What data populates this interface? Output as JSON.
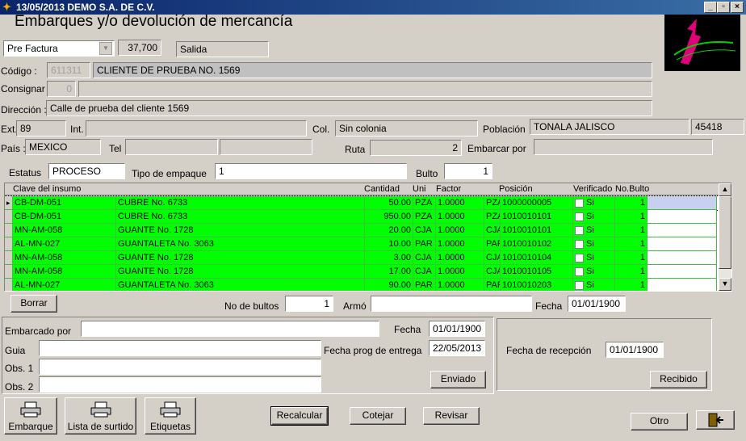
{
  "window": {
    "title": "13/05/2013  DEMO  S.A. DE C.V.",
    "heading": "Embarques y/o devolución de mercancía"
  },
  "header": {
    "doc_type": "Pre Factura",
    "number": "37,700",
    "movement": "Salida"
  },
  "customer": {
    "codigo_label": "Código :",
    "codigo": "611311",
    "nombre": "CLIENTE DE PRUEBA NO. 1569",
    "consignar_label": "Consignar",
    "consignar": "0",
    "direccion_label": "Dirección :",
    "direccion": "Calle de prueba del cliente 1569",
    "ext_label": "Ext.",
    "ext": "89",
    "int_label": "Int.",
    "int": "",
    "col_label": "Col.",
    "colonia": "Sin colonia",
    "poblacion_label": "Población",
    "poblacion": "TONALA  JALISCO",
    "cp": "45418",
    "pais_label": "País :",
    "pais": "MEXICO",
    "tel_label": "Tel",
    "ruta_label": "Ruta",
    "ruta": "2",
    "embarcar_label": "Embarcar por",
    "embarcar": ""
  },
  "status": {
    "estatus_label": "Estatus",
    "estatus": "PROCESO",
    "empaque_label": "Tipo de empaque",
    "empaque": "1",
    "bulto_label": "Bulto",
    "bulto": "1"
  },
  "grid": {
    "columns": [
      "Clave del insumo",
      "Cantidad",
      "Uni",
      "Factor",
      "Posición",
      "Verificado",
      "No.Bulto"
    ],
    "check_label": "Si",
    "rows": [
      {
        "clave": "CB-DM-051",
        "desc": "CUBRE No. 6733",
        "cantidad": "50.00",
        "uni": "PZA",
        "factor": "1.0000",
        "uni2": "PZA",
        "posicion": "1000000005",
        "bulto": "1"
      },
      {
        "clave": "CB-DM-051",
        "desc": "CUBRE No. 6733",
        "cantidad": "950.00",
        "uni": "PZA",
        "factor": "1.0000",
        "uni2": "PZA",
        "posicion": "1010010101",
        "bulto": "1"
      },
      {
        "clave": "MN-AM-058",
        "desc": "GUANTE No. 1728",
        "cantidad": "20.00",
        "uni": "CJA",
        "factor": "1.0000",
        "uni2": "CJA",
        "posicion": "1010010101",
        "bulto": "1"
      },
      {
        "clave": "AL-MN-027",
        "desc": "GUANTALETA No. 3063",
        "cantidad": "10.00",
        "uni": "PAR",
        "factor": "1.0000",
        "uni2": "PAR",
        "posicion": "1010010102",
        "bulto": "1"
      },
      {
        "clave": "MN-AM-058",
        "desc": "GUANTE No. 1728",
        "cantidad": "3.00",
        "uni": "CJA",
        "factor": "1.0000",
        "uni2": "CJA",
        "posicion": "1010010104",
        "bulto": "1"
      },
      {
        "clave": "MN-AM-058",
        "desc": "GUANTE No. 1728",
        "cantidad": "17.00",
        "uni": "CJA",
        "factor": "1.0000",
        "uni2": "CJA",
        "posicion": "1010010105",
        "bulto": "1"
      },
      {
        "clave": "AL-MN-027",
        "desc": "GUANTALETA No. 3063",
        "cantidad": "90.00",
        "uni": "PAR",
        "factor": "1.0000",
        "uni2": "PAR",
        "posicion": "1010010203",
        "bulto": "1"
      }
    ]
  },
  "below_grid": {
    "borrar": "Borrar",
    "no_bultos_label": "No de bultos",
    "no_bultos": "1",
    "armo_label": "Armó",
    "armo": "",
    "fecha_label": "Fecha",
    "fecha": "01/01/1900"
  },
  "shipping": {
    "embarcado_label": "Embarcado por",
    "embarcado": "",
    "fecha_label": "Fecha",
    "fecha": "01/01/1900",
    "guia_label": "Guia",
    "guia": "",
    "fecha_prog_label": "Fecha prog de entrega",
    "fecha_prog": "22/05/2013",
    "obs1_label": "Obs. 1",
    "obs1": "",
    "obs2_label": "Obs. 2",
    "obs2": "",
    "enviado": "Enviado"
  },
  "reception": {
    "label": "Fecha de recepción",
    "fecha": "01/01/1900",
    "recibido": "Recibido"
  },
  "toolbar": {
    "embarque": "Embarque",
    "lista": "Lista de surtido",
    "etiquetas": "Etiquetas",
    "recalcular": "Recalcular",
    "cotejar": "Cotejar",
    "revisar": "Revisar",
    "otro": "Otro"
  }
}
